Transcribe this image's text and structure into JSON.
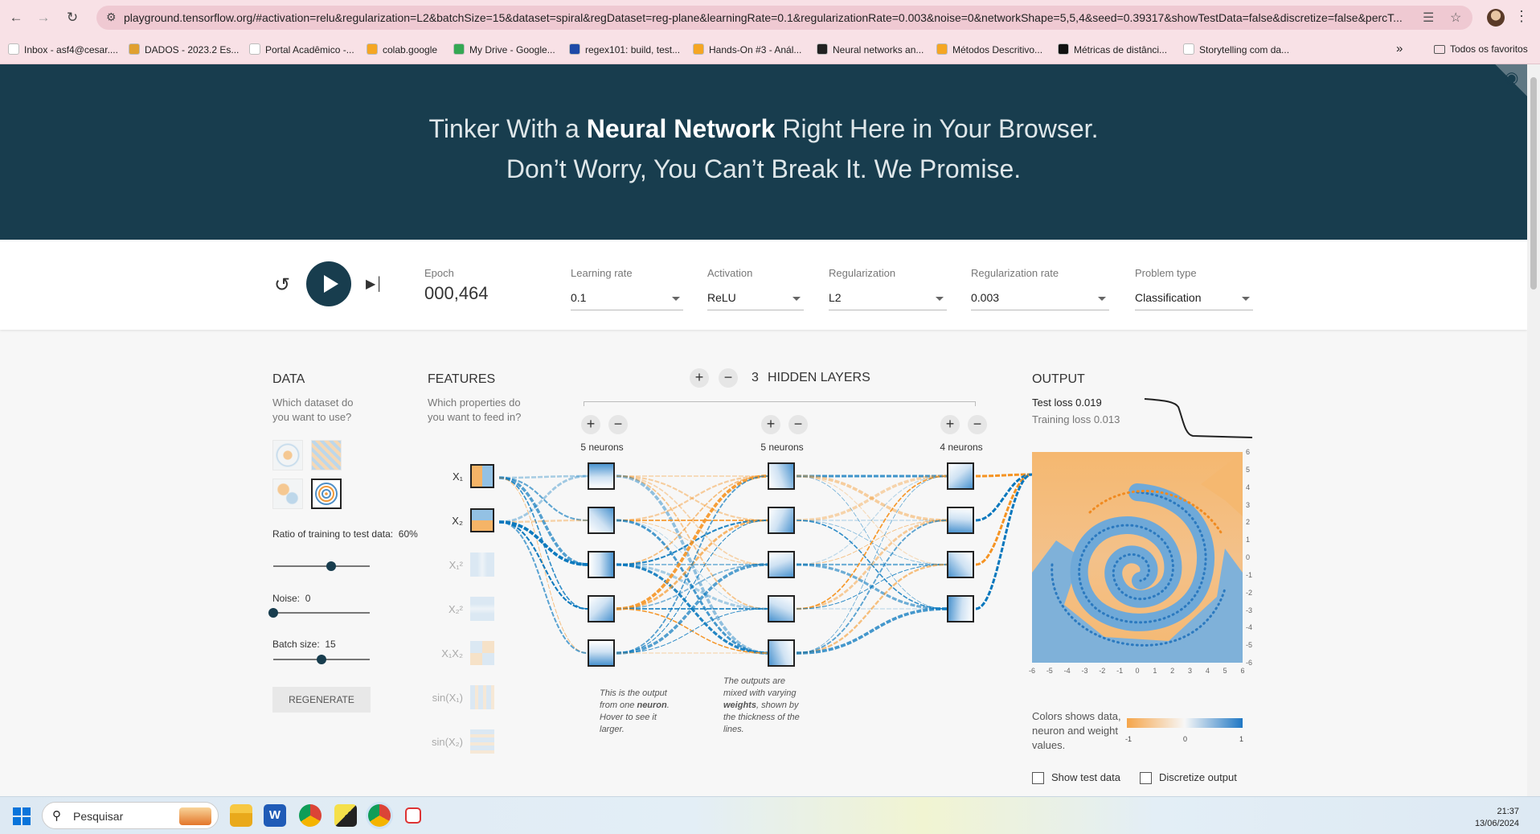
{
  "browser": {
    "url": "playground.tensorflow.org/#activation=relu&regularization=L2&batchSize=15&dataset=spiral&regDataset=reg-plane&learningRate=0.1&regularizationRate=0.003&noise=0&networkShape=5,5,4&seed=0.39317&showTestData=false&discretize=false&percT...",
    "bookmarks": [
      {
        "label": "Inbox - asf4@cesar....",
        "color": "#ffffff"
      },
      {
        "label": "DADOS - 2023.2 Es...",
        "color": "#e0a030"
      },
      {
        "label": "Portal Acadêmico -...",
        "color": "#ffffff"
      },
      {
        "label": "colab.google",
        "color": "#f5a623"
      },
      {
        "label": "My Drive - Google...",
        "color": "#34a853"
      },
      {
        "label": "regex101: build, test...",
        "color": "#1e4aa8"
      },
      {
        "label": "Hands-On #3 - Anál...",
        "color": "#f5a623"
      },
      {
        "label": "Neural networks an...",
        "color": "#222222"
      },
      {
        "label": "Métodos Descritivo...",
        "color": "#f5a623"
      },
      {
        "label": "Métricas de distânci...",
        "color": "#111111"
      },
      {
        "label": "Storytelling com da...",
        "color": "#ffffff"
      }
    ],
    "bookmarks_more": "»",
    "all_bookmarks": "Todos os favoritos"
  },
  "hero": {
    "line1_pre": "Tinker With a ",
    "line1_bold": "Neural Network",
    "line1_post": " Right Here in Your Browser.",
    "line2": "Don’t Worry, You Can’t Break It. We Promise."
  },
  "controls": {
    "epoch_label": "Epoch",
    "epoch_value": "000,464",
    "learning_rate_label": "Learning rate",
    "learning_rate_value": "0.1",
    "activation_label": "Activation",
    "activation_value": "ReLU",
    "regularization_label": "Regularization",
    "regularization_value": "L2",
    "reg_rate_label": "Regularization rate",
    "reg_rate_value": "0.003",
    "problem_type_label": "Problem type",
    "problem_type_value": "Classification"
  },
  "data_panel": {
    "title": "DATA",
    "subtitle": "Which dataset do you want to use?",
    "ratio_label": "Ratio of training to test data:",
    "ratio_value": "60%",
    "ratio_level": 0.6,
    "noise_label": "Noise:",
    "noise_value": "0",
    "noise_level": 0,
    "batch_label": "Batch size:",
    "batch_value": "15",
    "batch_level": 0.5,
    "regenerate": "REGENERATE"
  },
  "features_panel": {
    "title": "FEATURES",
    "subtitle": "Which properties do you want to feed in?",
    "features": [
      {
        "label": "X₁",
        "active": true
      },
      {
        "label": "X₂",
        "active": true
      },
      {
        "label": "X₁²",
        "active": false
      },
      {
        "label": "X₂²",
        "active": false
      },
      {
        "label": "X₁X₂",
        "active": false
      },
      {
        "label": "sin(X₁)",
        "active": false
      },
      {
        "label": "sin(X₂)",
        "active": false
      }
    ]
  },
  "network": {
    "hidden_count": "3",
    "hidden_title": "HIDDEN LAYERS",
    "plus": "+",
    "minus": "−",
    "layers": [
      {
        "neurons_label": "5 neurons"
      },
      {
        "neurons_label": "5 neurons"
      },
      {
        "neurons_label": "4 neurons"
      }
    ],
    "note_neuron_pre": "This is the output from one ",
    "note_neuron_bold": "neuron",
    "note_neuron_post": ". Hover to see it larger.",
    "note_weights_pre": "The outputs are mixed with varying ",
    "note_weights_bold": "weights",
    "note_weights_post": ", shown by the thickness of the lines."
  },
  "output_panel": {
    "title": "OUTPUT",
    "test_loss": "Test loss 0.019",
    "training_loss": "Training loss 0.013",
    "x_ticks": [
      "-6",
      "-5",
      "-4",
      "-3",
      "-2",
      "-1",
      "0",
      "1",
      "2",
      "3",
      "4",
      "5",
      "6"
    ],
    "y_ticks": [
      "6",
      "5",
      "4",
      "3",
      "2",
      "1",
      "0",
      "-1",
      "-2",
      "-3",
      "-4",
      "-5",
      "-6"
    ],
    "colors_note": "Colors shows data, neuron and weight values.",
    "colorbar_ticks": [
      "-1",
      "0",
      "1"
    ],
    "show_test_data": "Show test data",
    "discretize_output": "Discretize output"
  },
  "taskbar": {
    "search_placeholder": "Pesquisar",
    "time": "21:37",
    "date": "13/06/2024"
  },
  "colors": {
    "orange": "#f59322",
    "blue": "#0877bd",
    "header_bg": "#183d4e"
  }
}
